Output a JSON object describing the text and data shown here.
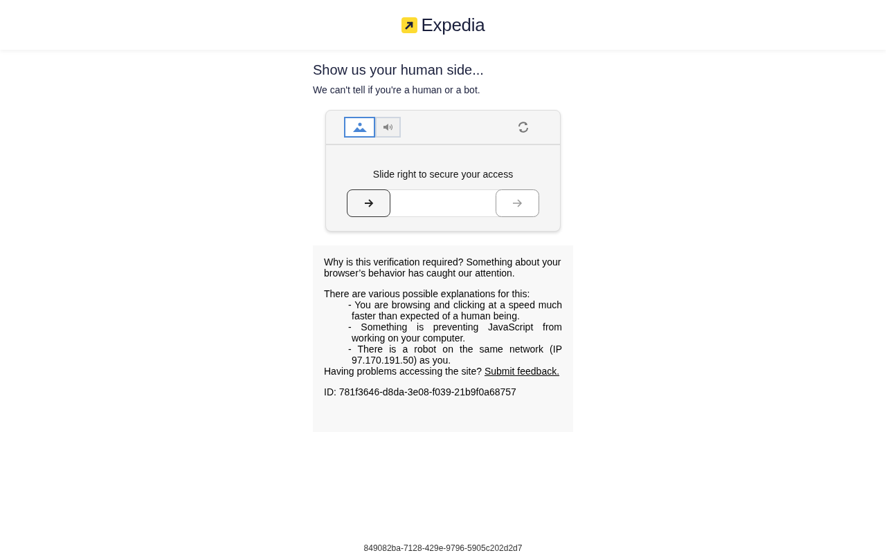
{
  "header": {
    "logo_text": "Expedia"
  },
  "heading": "Show us your human side...",
  "subheading": "We can't tell if you're a human or a bot.",
  "captcha": {
    "tabs": [
      {
        "kind": "image",
        "selected": true
      },
      {
        "kind": "audio",
        "selected": false
      }
    ],
    "instruction": "Slide right to secure your access",
    "slider": {
      "level": 0
    }
  },
  "info": {
    "intro": "Why is this verification required? Something about your browser’s behavior has caught our attention.",
    "explanations_title": "There are various possible explanations for this:",
    "explanations": [
      "- You are browsing and clicking at a speed much faster than expected of a human being.",
      "- Something is preventing JavaScript from working on your computer.",
      "- There is a robot on the same network (IP 97.170.191.50) as you."
    ],
    "problems_text": "Having problems accessing the site?",
    "feedback_link": "Submit feedback.",
    "id_text": "ID: 781f3646-d8da-3e08-f039-21b9f0a68757"
  },
  "footer_id": "849082ba-7128-429e-9796-5905c202d2d7"
}
